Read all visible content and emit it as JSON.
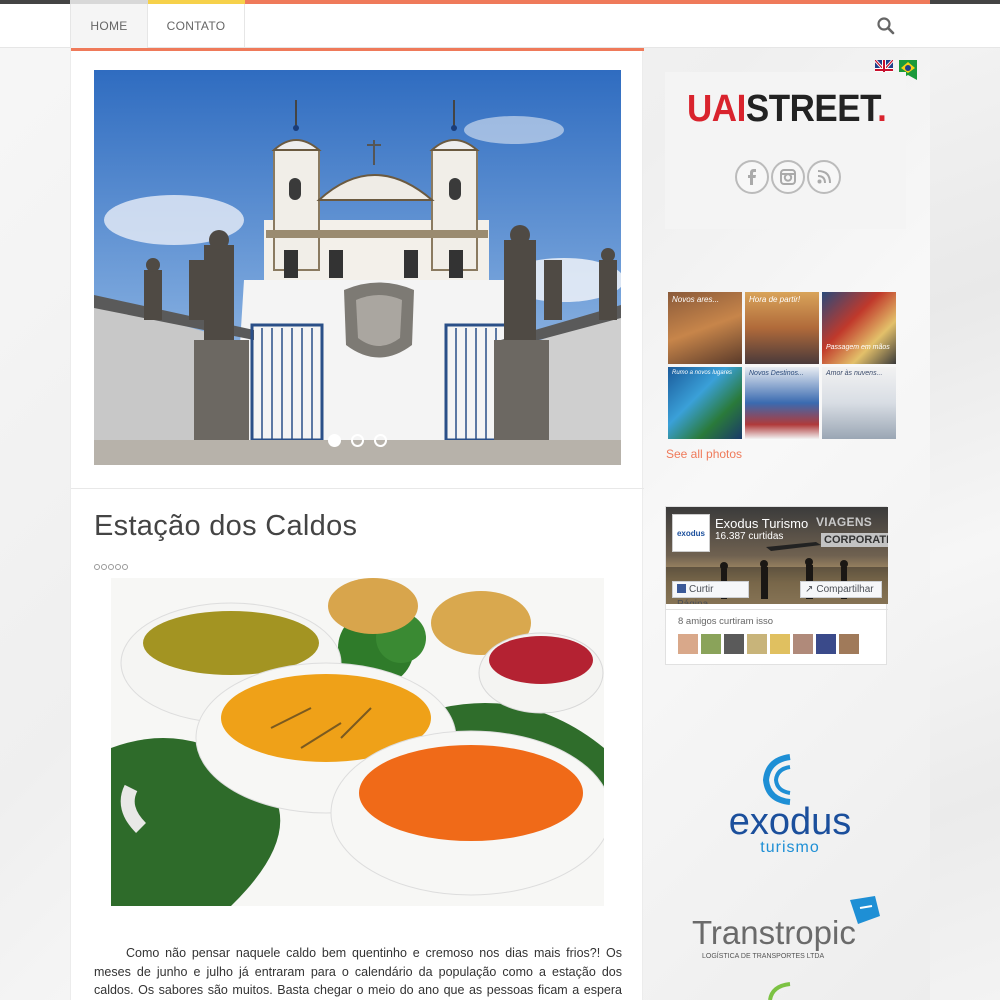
{
  "nav": {
    "home_label": "HOME",
    "contato_label": "CONTATO"
  },
  "slider": {
    "slide_count": 3,
    "active_index": 0
  },
  "post": {
    "title": "Estação dos Caldos",
    "rating": 0,
    "body": "Como não pensar naquele caldo bem quentinho e cremoso nos dias mais frios?! Os meses de junho e julho já entraram para o calendário da população como a estação dos caldos. Os sabores são muitos. Basta chegar o meio do ano que as pessoas ficam a espera dos primeiros caldos para"
  },
  "sidebar": {
    "logo": {
      "part1": "UAI",
      "part2": "STREET",
      "part3": "."
    },
    "flags": [
      "uk-flag-icon",
      "brazil-flag-icon"
    ],
    "social": [
      "facebook-icon",
      "instagram-icon",
      "rss-icon"
    ],
    "photos": [
      {
        "caption": "Novos ares..."
      },
      {
        "caption": "Hora de partir!"
      },
      {
        "caption": "Passagem em mãos"
      },
      {
        "caption": "Rumo a novos lugares"
      },
      {
        "caption": "Novos Destinos..."
      },
      {
        "caption": "Amor às nuvens..."
      }
    ],
    "see_all": "See all photos",
    "facebook": {
      "page_name": "Exodus Turismo",
      "likes": "16.387 curtidas",
      "cover_text1": "VIAGENS",
      "cover_text2": "CORPORATIVA",
      "like_button": "Curtir Página",
      "share_button": "Compartilhar",
      "friends_text": "8 amigos curtiram isso",
      "logo_text": "exodus"
    },
    "exodus": {
      "name": "exodus",
      "sub": "turismo"
    },
    "transtropic": {
      "name": "Transtropic",
      "sub": "LOGÍSTICA DE TRANSPORTES LTDA"
    }
  },
  "colors": {
    "accent": "#ef7a5a",
    "brand_red": "#d9232d",
    "exodus_blue": "#1b4f9c",
    "exodus_cyan": "#1e8fd5"
  }
}
